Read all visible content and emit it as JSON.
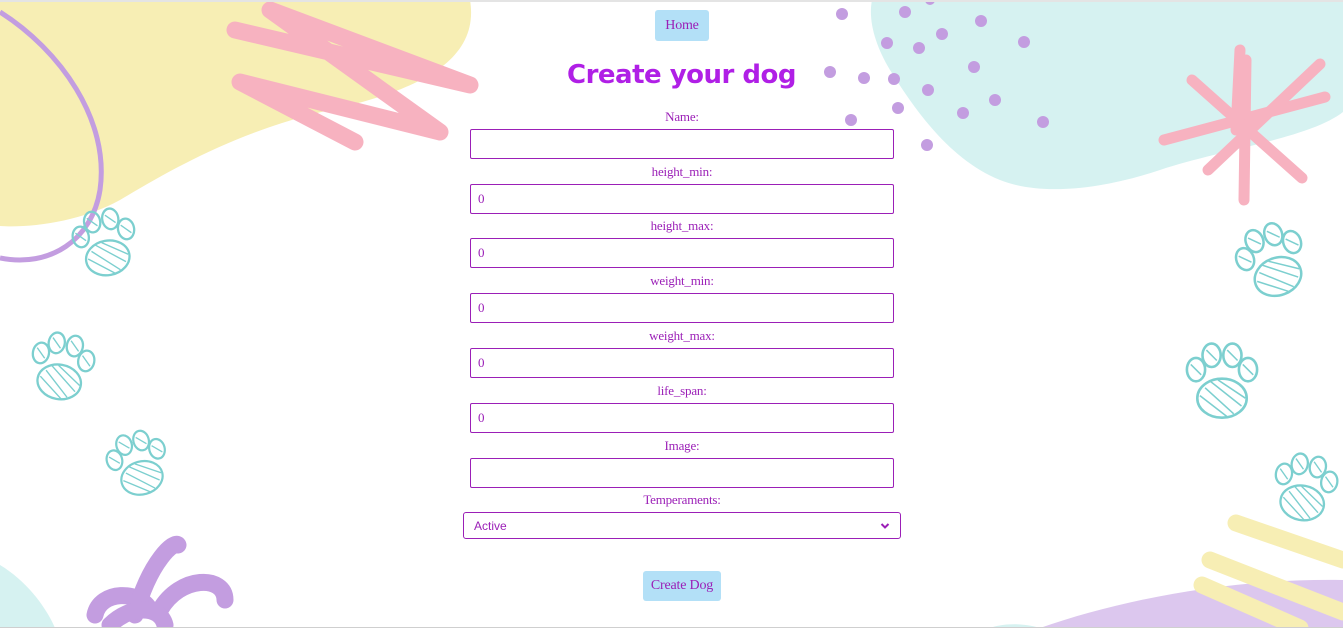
{
  "nav": {
    "home_label": "Home"
  },
  "form": {
    "title": "Create your dog",
    "fields": [
      {
        "label": "Name:",
        "value": ""
      },
      {
        "label": "height_min:",
        "value": "0"
      },
      {
        "label": "height_max:",
        "value": "0"
      },
      {
        "label": "weight_min:",
        "value": "0"
      },
      {
        "label": "weight_max:",
        "value": "0"
      },
      {
        "label": "life_span:",
        "value": "0"
      },
      {
        "label": "Image:",
        "value": ""
      }
    ],
    "temperaments": {
      "label": "Temperaments:",
      "selected": "Active"
    },
    "submit_label": "Create Dog"
  },
  "colors": {
    "accent": "#9b1fb7",
    "title": "#b01fe6",
    "button_bg": "#b3e0f7",
    "blob_yellow": "#f7eeb4",
    "blob_mint": "#d6f2f1",
    "pink": "#f7b2c0",
    "lavender": "#c39de0",
    "paw_teal": "#7ccfcf"
  },
  "decorations": [
    "paw-print-icon",
    "pink-scribble",
    "pink-star-scribble",
    "purple-dots",
    "purple-flower",
    "yellow-scribble"
  ]
}
